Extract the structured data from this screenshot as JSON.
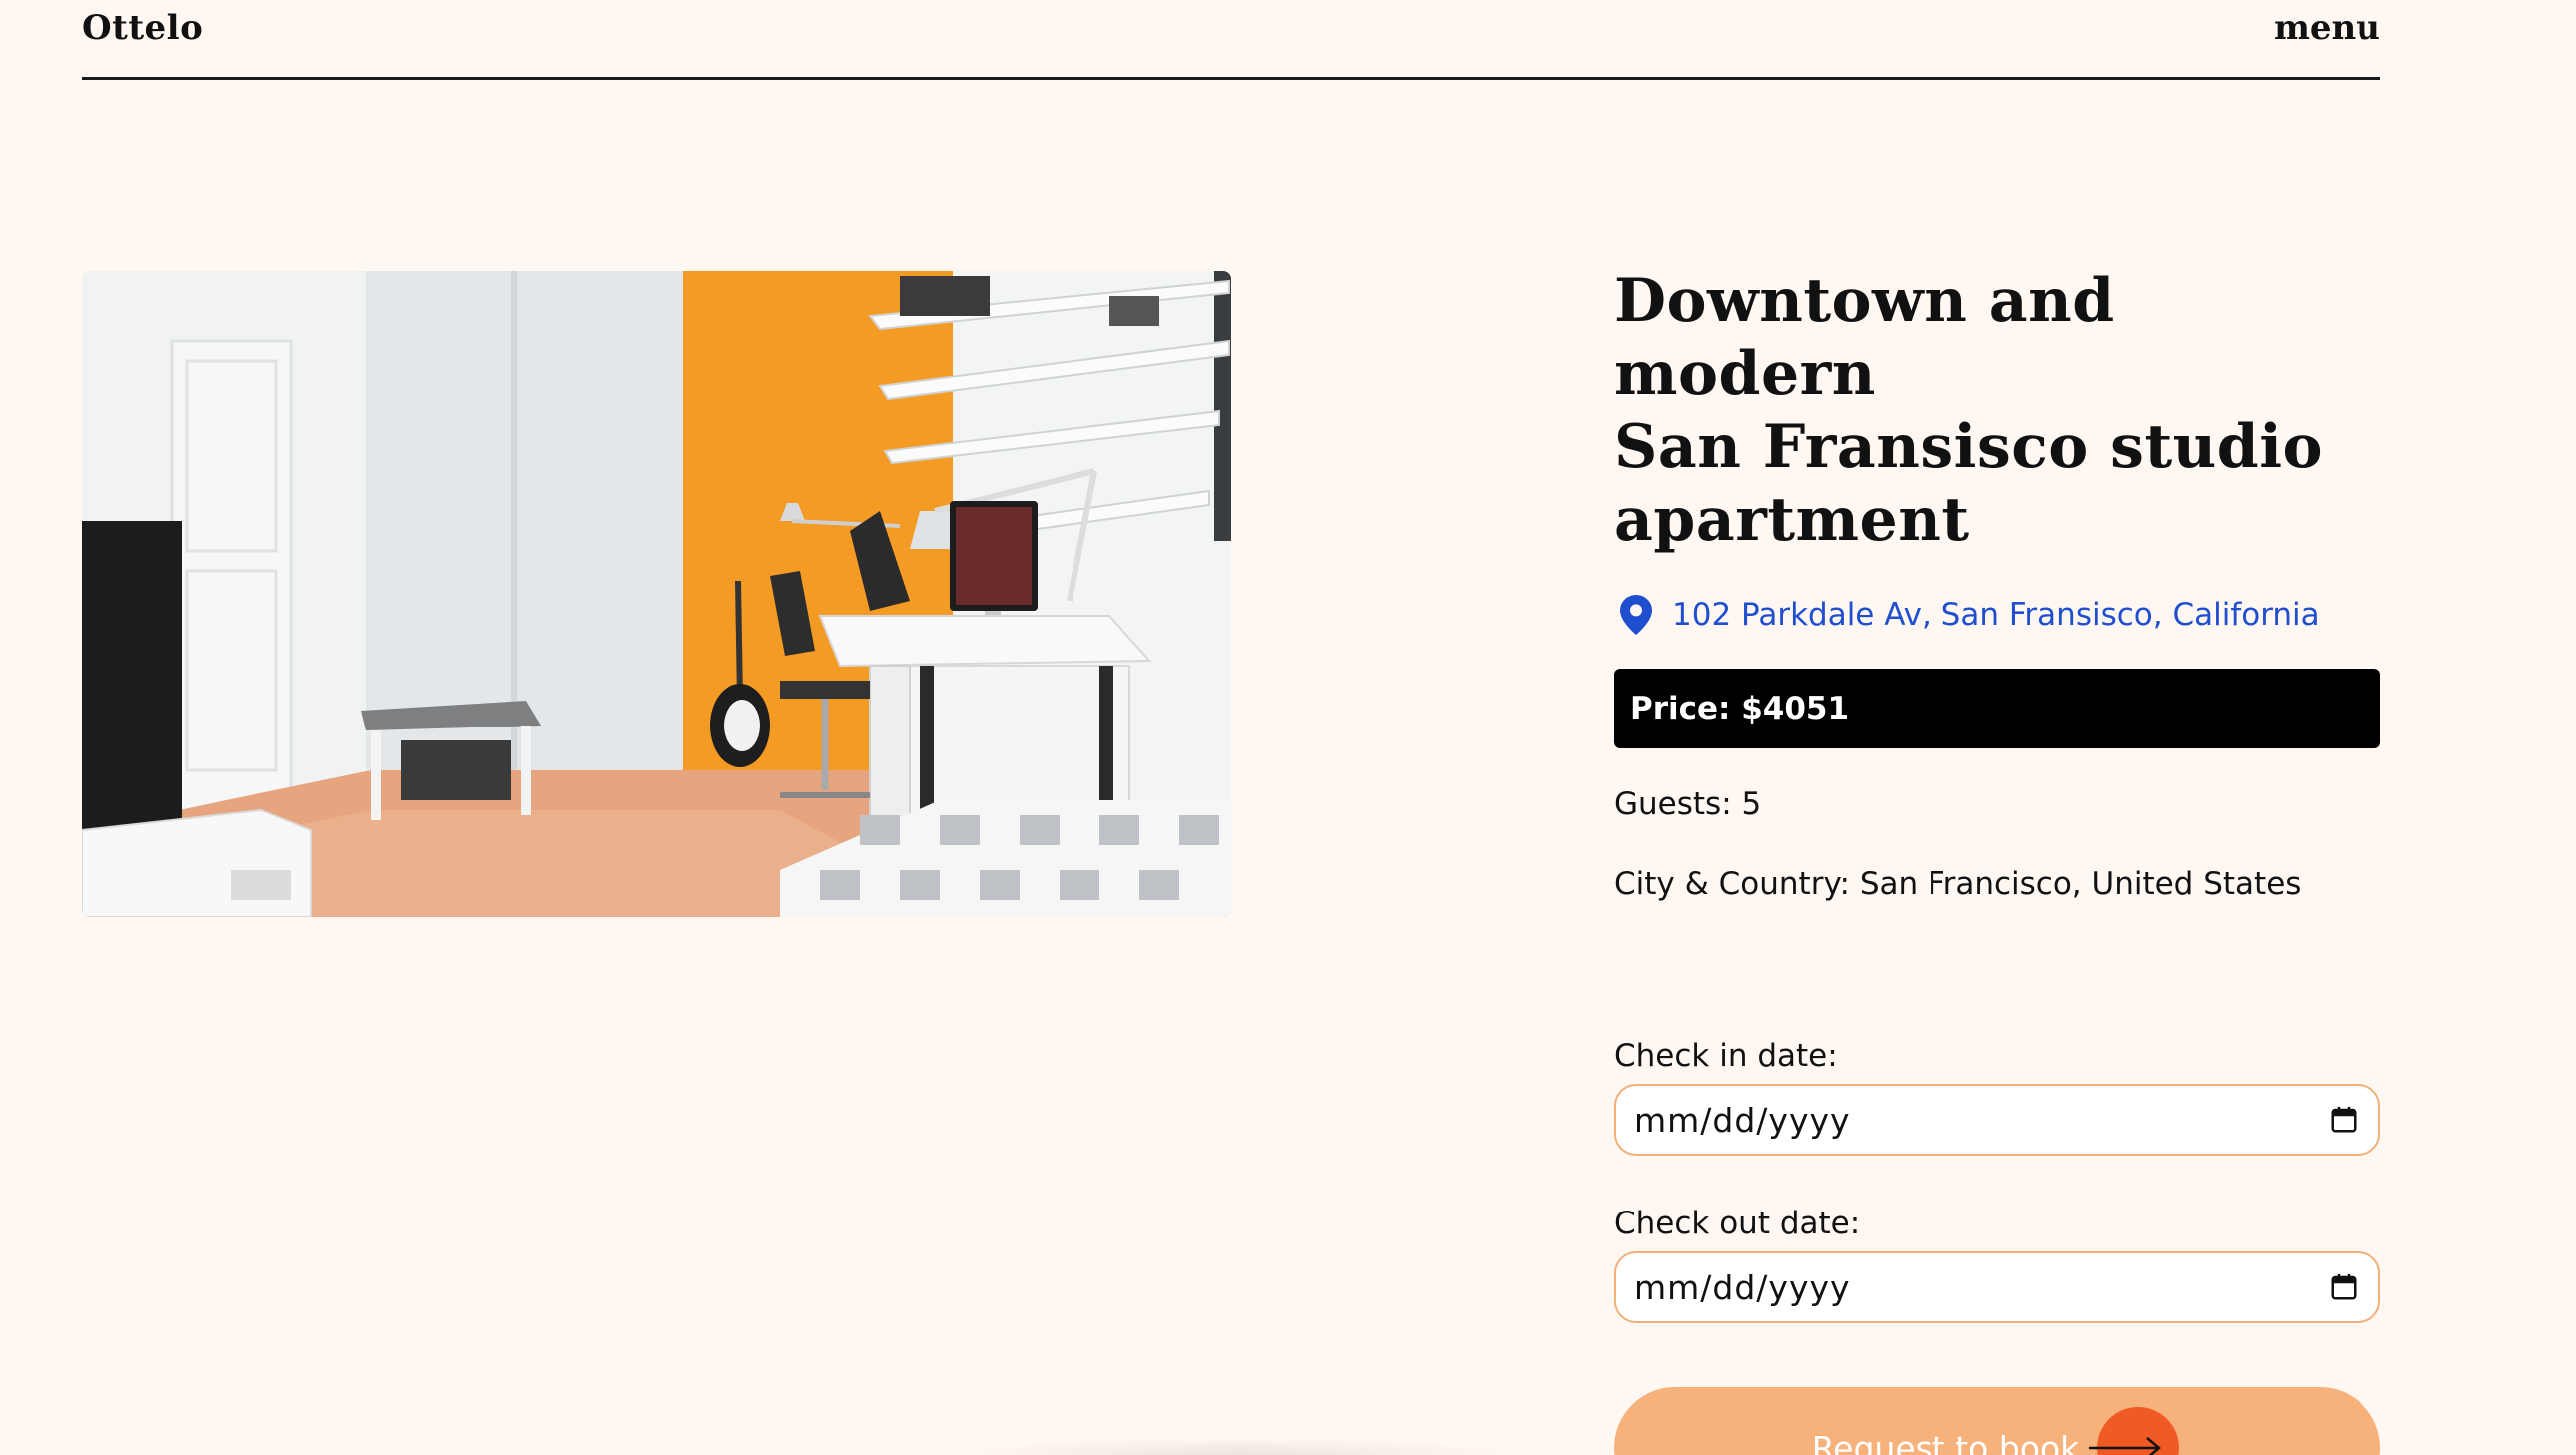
{
  "header": {
    "logo": "Ottelo",
    "menu_label": "menu"
  },
  "listing": {
    "photo": {
      "description": "Bright studio room with orange accent wall and white desk"
    },
    "title_lines": [
      "Downtown and modern",
      "San Fransisco studio",
      "apartment"
    ],
    "address": "102 Parkdale Av, San Fransisco, California",
    "price": "Price: $4051",
    "guests": "Guests: 5",
    "city_country": "City & Country: San Francisco, United States"
  },
  "booking": {
    "checkin_label": "Check in date:",
    "checkin_placeholder": "mm/dd/yyyy",
    "checkout_label": "Check out date:",
    "checkout_placeholder": "mm/dd/yyyy",
    "submit_label": "Request to book"
  },
  "colors": {
    "background": "#fff7f2",
    "link_blue": "#1f4fcf",
    "button_peach": "#f7b27c",
    "arrow_orange": "#f05a24",
    "input_border": "#f2b078"
  },
  "icons": {
    "location": "map-pin-icon",
    "calendar": "calendar-icon",
    "submit": "arrow-right-icon"
  }
}
